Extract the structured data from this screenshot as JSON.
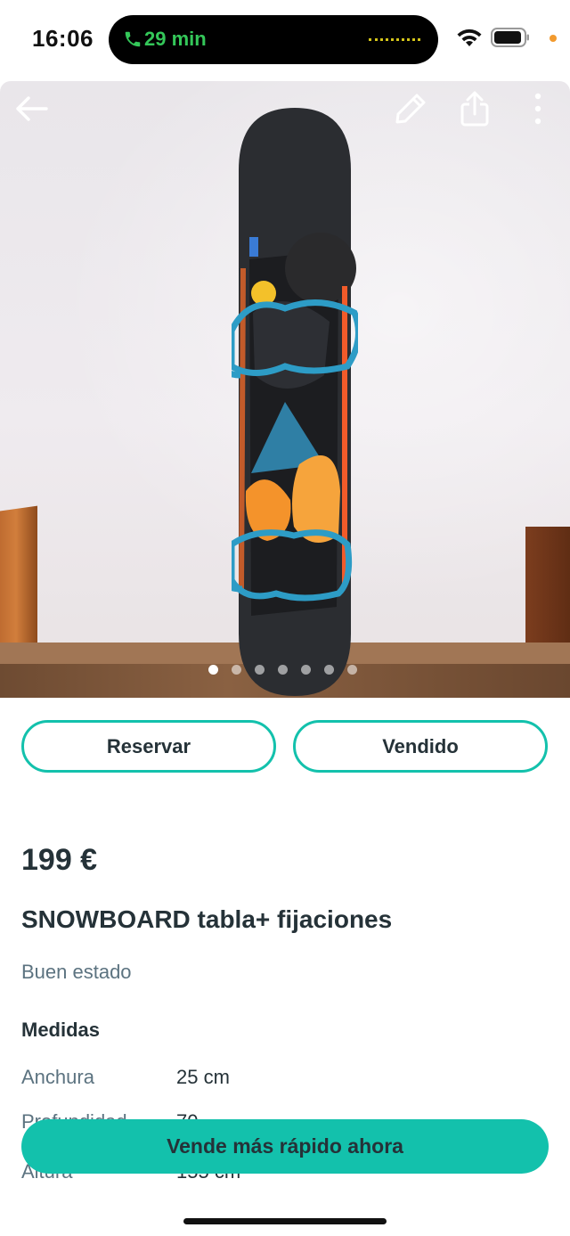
{
  "status_bar": {
    "time": "16:06",
    "call_duration": "29 min"
  },
  "photo": {
    "pages_total": 7,
    "active_page": 1,
    "icons": [
      "back-arrow-icon",
      "edit-pencil-icon",
      "share-icon",
      "more-vertical-icon"
    ]
  },
  "actions": {
    "reserve_label": "Reservar",
    "sold_label": "Vendido"
  },
  "listing": {
    "price": "199 €",
    "title": "SNOWBOARD tabla+ fijaciones",
    "condition": "Buen estado",
    "measures_title": "Medidas",
    "measures": [
      {
        "label": "Anchura",
        "value": "25 cm"
      },
      {
        "label": "Profundidad",
        "value": "70"
      },
      {
        "label": "Altura",
        "value": "155 cm"
      }
    ]
  },
  "cta": {
    "label": "Vende más rápido ahora"
  },
  "colors": {
    "accent": "#13c1ac",
    "text": "#253238",
    "muted": "#5c7380"
  }
}
